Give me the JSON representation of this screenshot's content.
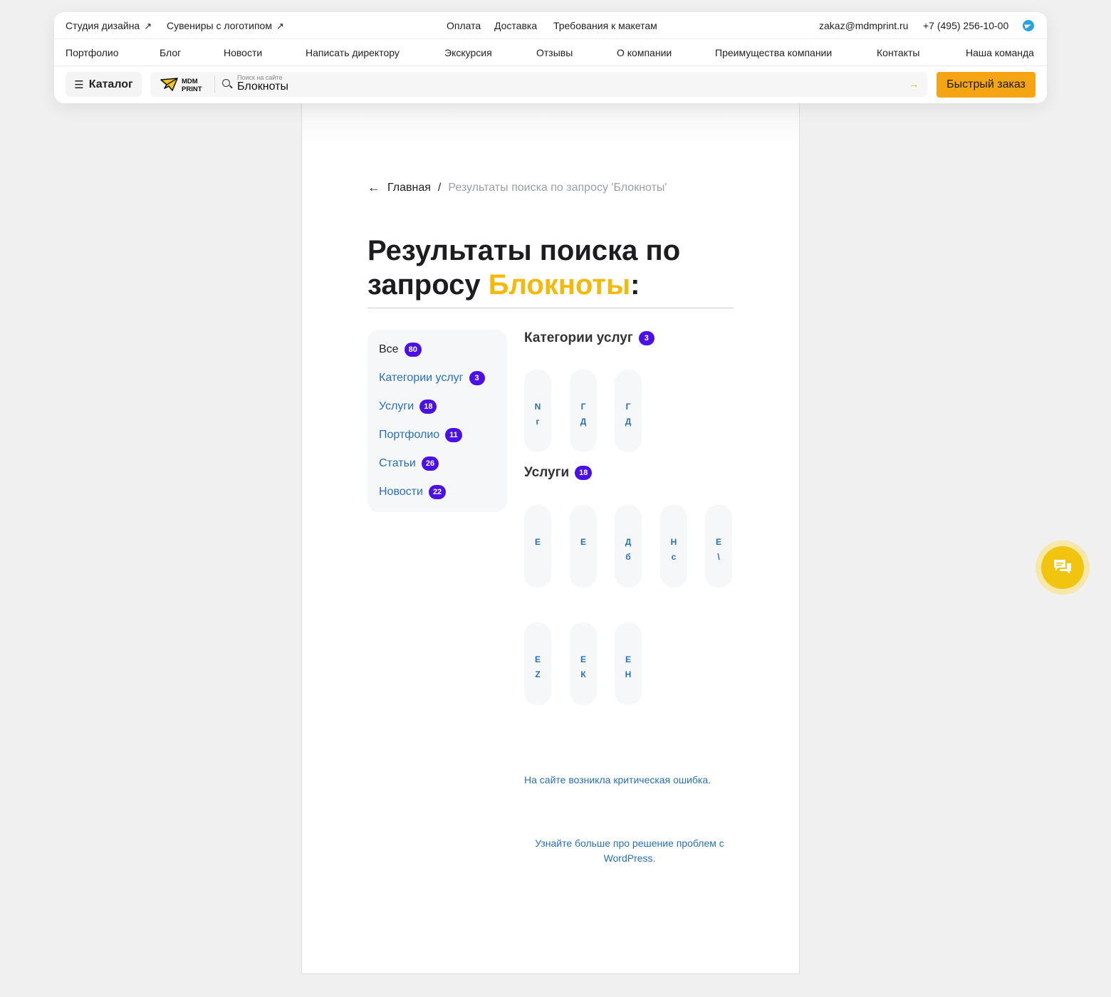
{
  "header": {
    "top_left": [
      {
        "label": "Студия дизайна"
      },
      {
        "label": "Сувениры с логотипом"
      }
    ],
    "top_center": [
      "Оплата",
      "Доставка",
      "Требования к макетам"
    ],
    "email": "zakaz@mdmprint.ru",
    "phone": "+7 (495) 256-10-00",
    "nav": [
      "Портфолио",
      "Блог",
      "Новости",
      "Написать директору",
      "Экскурсия",
      "Отзывы",
      "О компании",
      "Преимущества компании",
      "Контакты",
      "Наша команда"
    ],
    "catalog_label": "Каталог",
    "logo_line1": "MDM",
    "logo_line2": "PRINT",
    "search_placeholder": "Поиск на сайте",
    "search_value": "Блокноты",
    "quick_order": "Быстрый заказ"
  },
  "breadcrumb": {
    "home": "Главная",
    "sep": "/",
    "current": "Результаты поиска по запросу 'Блокноты'"
  },
  "title": {
    "prefix": "Результаты поиска по запросу ",
    "query": "Блокноты",
    "suffix": ":"
  },
  "filters": [
    {
      "label": "Все",
      "count": "80",
      "active": true
    },
    {
      "label": "Категории услуг",
      "count": "3"
    },
    {
      "label": "Услуги",
      "count": "18"
    },
    {
      "label": "Портфолио",
      "count": "11"
    },
    {
      "label": "Статьи",
      "count": "26"
    },
    {
      "label": "Новости",
      "count": "22"
    }
  ],
  "sections": {
    "categories": {
      "title": "Категории услуг",
      "count": "3",
      "cards": [
        [
          "N",
          "г"
        ],
        [
          "Г",
          "Д"
        ],
        [
          "Г",
          "Д"
        ]
      ]
    },
    "services": {
      "title": "Услуги",
      "count": "18",
      "cards": [
        [
          "Е"
        ],
        [
          "Е"
        ],
        [
          "Д",
          "б"
        ],
        [
          "Н",
          "с"
        ],
        [
          "Е",
          "\\"
        ],
        [
          "Е",
          "Z"
        ],
        [
          "Е",
          "К"
        ],
        [
          "Е",
          "Н"
        ]
      ]
    }
  },
  "error": {
    "line1": "На сайте возникла критическая ошибка.",
    "line2": "Узнайте больше про решение проблем с WordPress."
  },
  "colors": {
    "accent": "#f5a413",
    "query": "#f4b90b",
    "badge": "#4b10e6",
    "link": "#2870b6"
  }
}
